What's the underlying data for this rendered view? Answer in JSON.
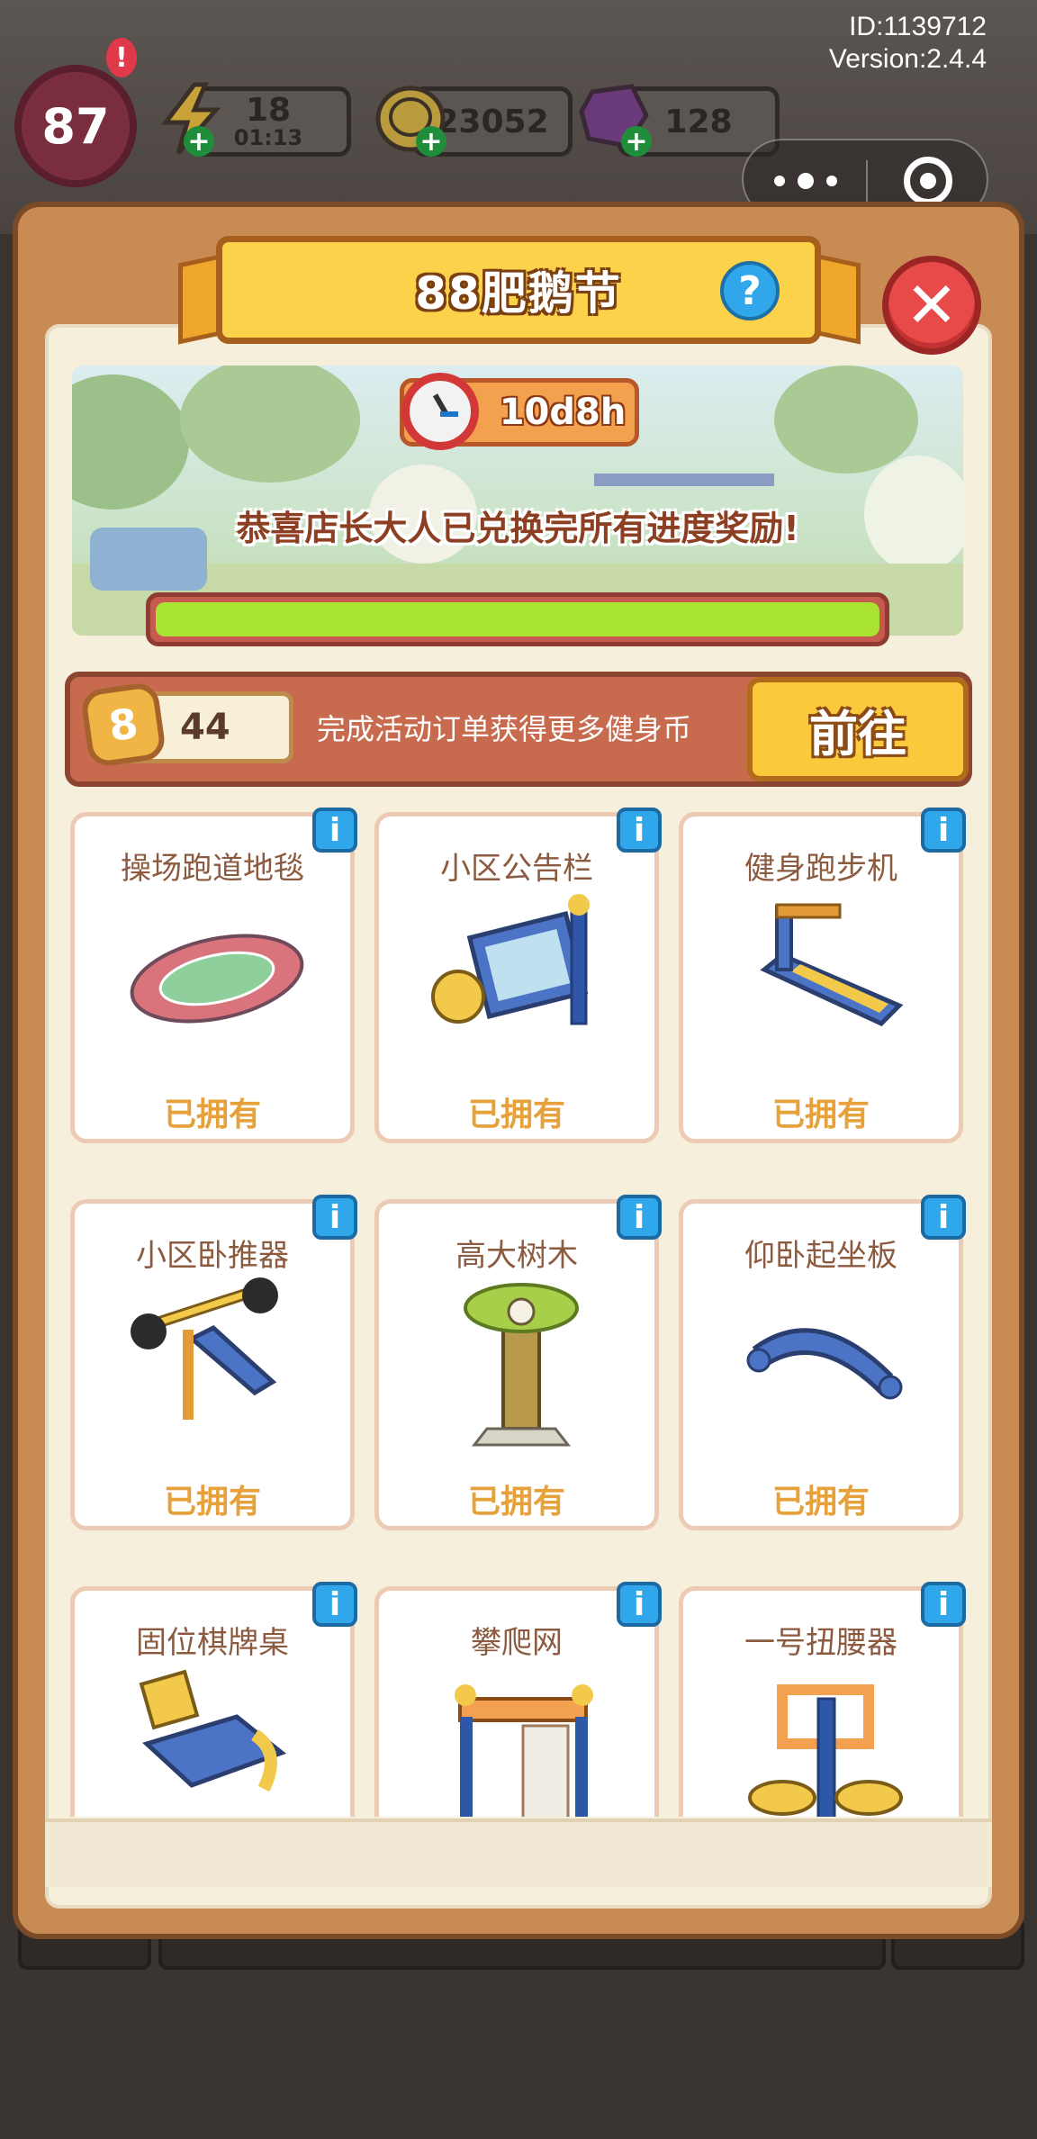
{
  "hud": {
    "level": "87",
    "level_alert": "!",
    "energy": "18",
    "energy_timer": "01:13",
    "coins": "23052",
    "gems": "128",
    "id_text": "ID:1139712",
    "version_text": "Version:2.4.4"
  },
  "panel": {
    "title": "88肥鹅节",
    "help": "?",
    "close": "✕",
    "timer": "10d8h",
    "congrats": "恭喜店长大人已兑换完所有进度奖励!",
    "progress": 1.0
  },
  "coin_bar": {
    "coin_label": "8",
    "count": "44",
    "description": "完成活动订单获得更多健身币",
    "go_label": "前往"
  },
  "items": [
    {
      "name": "操场跑道地毯",
      "status": "已拥有",
      "icon": "track-icon"
    },
    {
      "name": "小区公告栏",
      "status": "已拥有",
      "icon": "billboard-icon"
    },
    {
      "name": "健身跑步机",
      "status": "已拥有",
      "icon": "treadmill-icon"
    },
    {
      "name": "小区卧推器",
      "status": "已拥有",
      "icon": "bench-press-icon"
    },
    {
      "name": "高大树木",
      "status": "已拥有",
      "icon": "tree-icon"
    },
    {
      "name": "仰卧起坐板",
      "status": "已拥有",
      "icon": "situp-board-icon"
    },
    {
      "name": "固位棋牌桌",
      "status": "",
      "icon": "chess-table-icon"
    },
    {
      "name": "攀爬网",
      "status": "",
      "icon": "climbing-net-icon"
    },
    {
      "name": "一号扭腰器",
      "status": "",
      "icon": "waist-twister-icon"
    }
  ],
  "colors": {
    "panel": "#c98b54",
    "accent_blue": "#30a7ea",
    "owned_text": "#e6a13a",
    "progress_fill": "#a8e334"
  }
}
